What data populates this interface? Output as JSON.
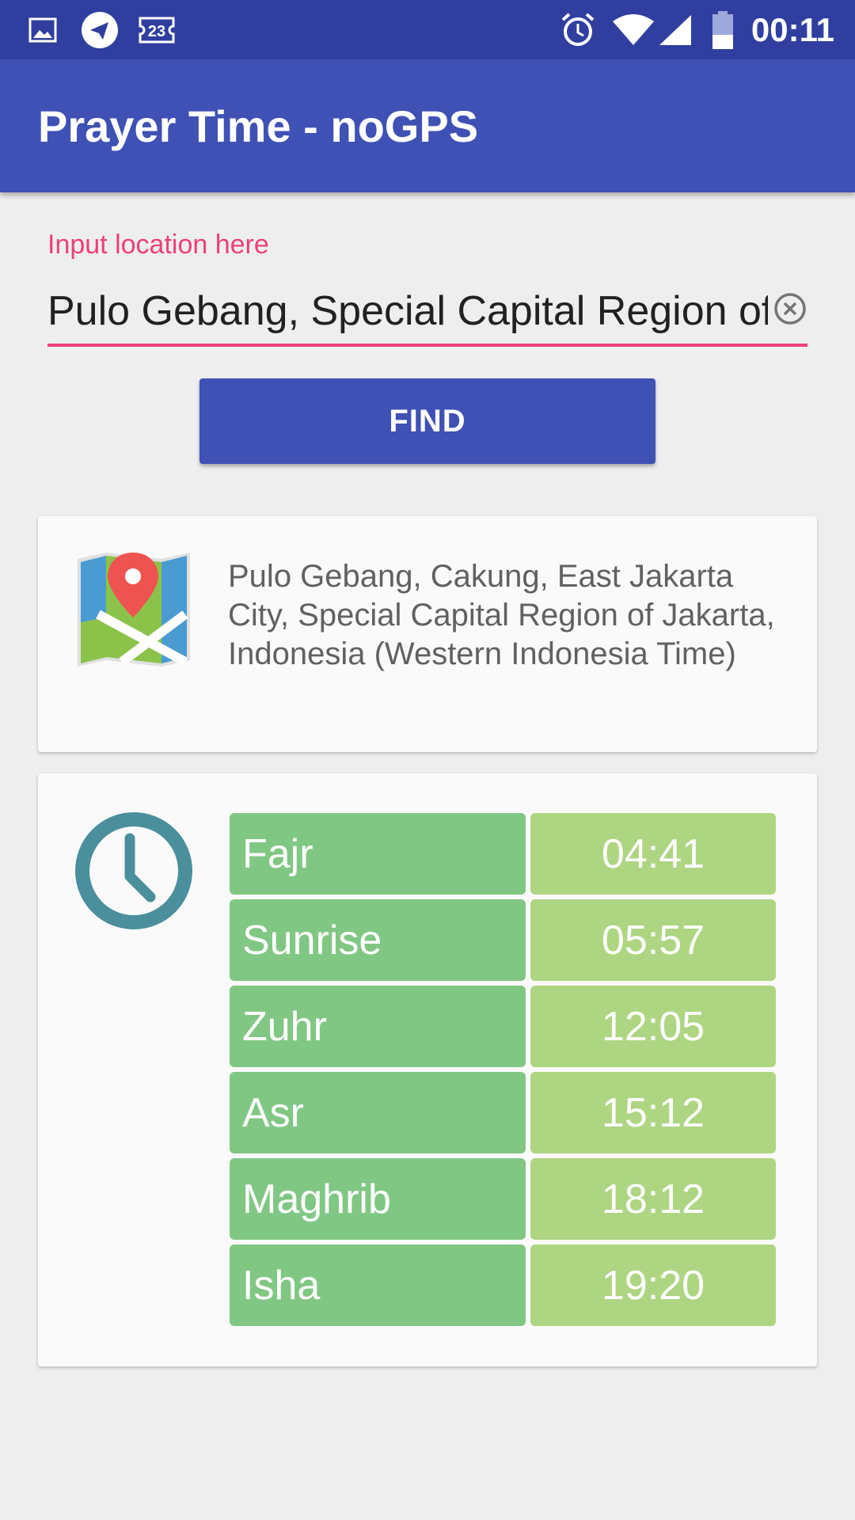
{
  "status_bar": {
    "time": "00:11",
    "notification_count": "23",
    "icons": [
      "image-icon",
      "telegram-icon",
      "calendar-icon",
      "alarm-icon",
      "wifi-icon",
      "signal-icon",
      "battery-icon"
    ]
  },
  "app_bar": {
    "title": "Prayer Time - noGPS"
  },
  "location_input": {
    "label": "Input location here",
    "value": "Pulo Gebang, Special Capital Region of Jakarta, Indonesia"
  },
  "find_button": {
    "label": "FIND"
  },
  "location_card": {
    "address": "Pulo Gebang, Cakung, East Jakarta City, Special Capital Region of Jakarta, Indonesia (Western Indonesia Time)"
  },
  "prayer_times": [
    {
      "name": "Fajr",
      "time": "04:41"
    },
    {
      "name": "Sunrise",
      "time": "05:57"
    },
    {
      "name": "Zuhr",
      "time": "12:05"
    },
    {
      "name": "Asr",
      "time": "15:12"
    },
    {
      "name": "Maghrib",
      "time": "18:12"
    },
    {
      "name": "Isha",
      "time": "19:20"
    }
  ],
  "colors": {
    "primary": "#3f51b5",
    "primary_dark": "#303f9f",
    "accent": "#ec407a",
    "name_cell": "#81c784",
    "time_cell": "#aed581",
    "clock": "#4a8f9b"
  }
}
